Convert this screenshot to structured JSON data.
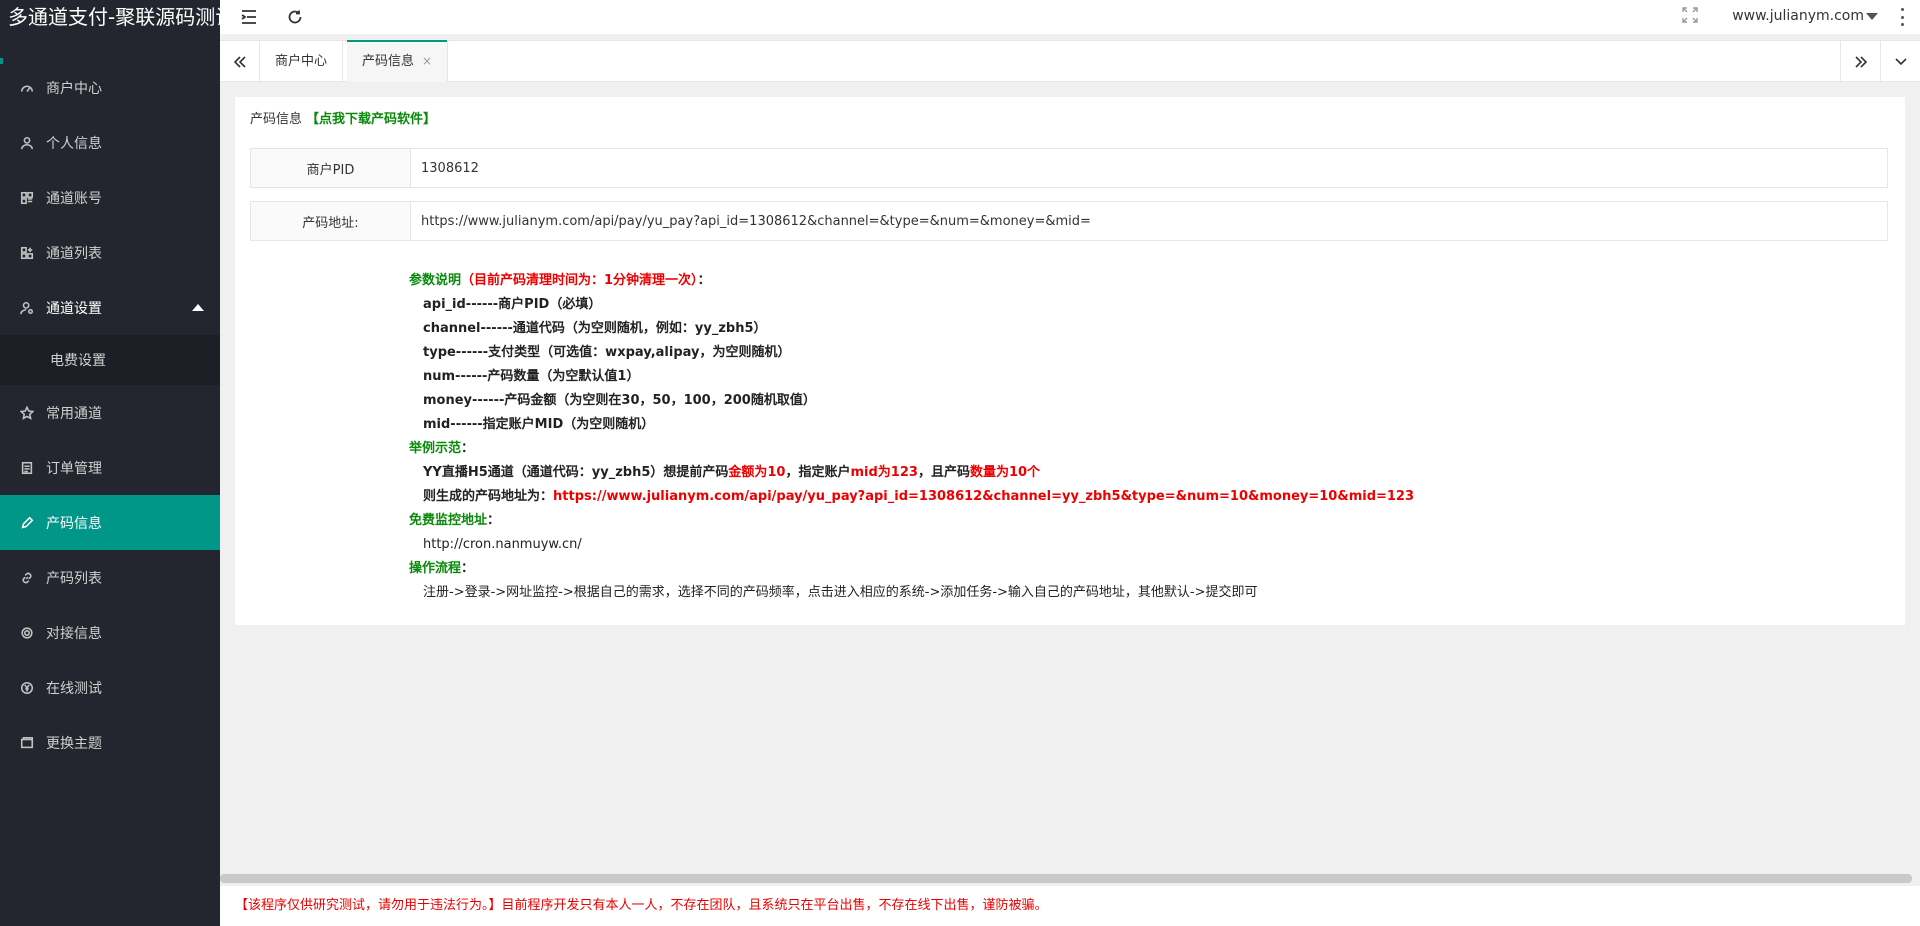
{
  "app": {
    "title": "多通道支付-聚联源码测试"
  },
  "sidebar": {
    "items": [
      {
        "label": "商户中心",
        "icon": "dashboard-icon"
      },
      {
        "label": "个人信息",
        "icon": "user-icon"
      },
      {
        "label": "通道账号",
        "icon": "grid-icon"
      },
      {
        "label": "通道列表",
        "icon": "apps-icon"
      },
      {
        "label": "通道设置",
        "icon": "user-settings-icon"
      },
      {
        "label": "常用通道",
        "icon": "star-icon"
      },
      {
        "label": "订单管理",
        "icon": "document-icon"
      },
      {
        "label": "产码信息",
        "icon": "pencil-icon"
      },
      {
        "label": "产码列表",
        "icon": "link-icon"
      },
      {
        "label": "对接信息",
        "icon": "gear-icon"
      },
      {
        "label": "在线测试",
        "icon": "yen-icon"
      },
      {
        "label": "更换主题",
        "icon": "theme-icon"
      }
    ],
    "submenu": [
      {
        "label": "电费设置"
      }
    ],
    "active": "产码信息"
  },
  "header": {
    "site": "www.julianym.com"
  },
  "tabs": [
    {
      "label": "商户中心"
    },
    {
      "label": "产码信息",
      "close": "×"
    }
  ],
  "card": {
    "title": "产码信息",
    "download_link": "【点我下载产码软件】",
    "pid_label": "商户PID",
    "pid_value": "1308612",
    "url_label": "产码地址:",
    "url_value": "https://www.julianym.com/api/pay/yu_pay?api_id=1308612&channel=&type=&num=&money=&mid="
  },
  "desc": {
    "params_title": "参数说明",
    "params_note": "（目前产码清理时间为：1分钟清理一次）",
    "colon": "：",
    "params": [
      "api_id------商户PID（必填）",
      "channel------通道代码（为空则随机，例如：yy_zbh5）",
      "type------支付类型（可选值：wxpay,alipay，为空则随机）",
      "num------产码数量（为空默认值1）",
      "money------产码金额（为空则在30，50，100，200随机取值）",
      "mid------指定账户MID（为空则随机）"
    ],
    "example_title": "举例示范",
    "example_a": "YY直播H5通道（通道代码：yy_zbh5）想提前产码",
    "example_b": "金额为10",
    "example_c": "，指定账户",
    "example_d": "mid为123",
    "example_e": "，且产码",
    "example_f": "数量为10个",
    "gen_label": "则生成的产码地址为：",
    "gen_url": "https://www.julianym.com/api/pay/yu_pay?api_id=1308612&channel=yy_zbh5&type=&num=10&money=10&mid=123",
    "monitor_title": "免费监控地址",
    "monitor_url": "http://cron.nanmuyw.cn/",
    "flow_title": "操作流程",
    "flow_text": "注册->登录->网址监控->根据自己的需求，选择不同的产码频率，点击进入相应的系统->添加任务->输入自己的产码地址，其他默认->提交即可",
    "colon2": "："
  },
  "footer": {
    "text": "【该程序仅供研究测试，请勿用于违法行为。】目前程序开发只有本人一人，不存在团队，且系统只在平台出售，不存在线下出售，谨防被骗。"
  },
  "colors": {
    "accent": "#009688",
    "sidebar_bg": "#23262e",
    "green": "#0a8a0a",
    "red": "#ee0000"
  }
}
